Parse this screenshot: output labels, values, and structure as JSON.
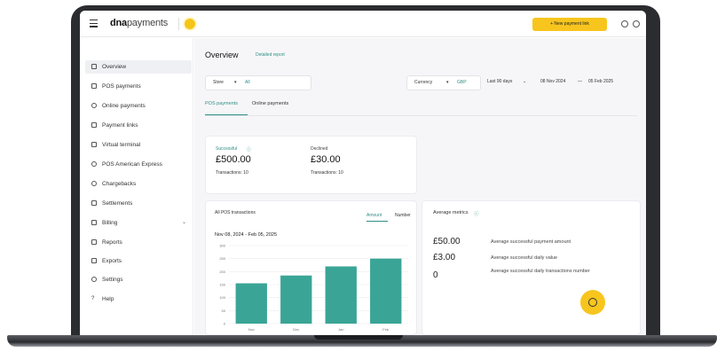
{
  "brand": {
    "bold": "dna",
    "light": "payments"
  },
  "header": {
    "new_payment_label": "+ New payment link"
  },
  "sidebar": {
    "items": [
      {
        "label": "Overview",
        "icon": "home-icon",
        "active": true
      },
      {
        "label": "POS payments",
        "icon": "pos-icon"
      },
      {
        "label": "Online payments",
        "icon": "globe-icon"
      },
      {
        "label": "Payment links",
        "icon": "link-icon"
      },
      {
        "label": "Virtual terminal",
        "icon": "terminal-icon"
      },
      {
        "label": "POS American Express",
        "icon": "amex-icon"
      },
      {
        "label": "Chargebacks",
        "icon": "chargeback-icon"
      },
      {
        "label": "Settlements",
        "icon": "document-icon"
      },
      {
        "label": "Billing",
        "icon": "billing-icon",
        "expandable": true
      },
      {
        "label": "Reports",
        "icon": "report-icon"
      },
      {
        "label": "Exports",
        "icon": "export-icon"
      },
      {
        "label": "Settings",
        "icon": "gear-icon"
      },
      {
        "label": "Help",
        "icon": "help-icon"
      }
    ]
  },
  "overview": {
    "title": "Overview",
    "detailed_report": "Detailed report"
  },
  "filters": {
    "store_label": "Store",
    "store_value": "All",
    "currency_label": "Currency",
    "currency_value": "GBP",
    "period_label": "Last 90 days",
    "date_from": "08 Nov 2024",
    "date_to": "05 Feb 2025"
  },
  "tabs": {
    "pos": "POS payments",
    "online": "Online payments"
  },
  "kpis": {
    "successful_label": "Successful",
    "successful_value": "£500.00",
    "successful_sub": "Transactions: 10",
    "declined_label": "Declined",
    "declined_value": "£30.00",
    "declined_sub": "Transactions: 10"
  },
  "chart_panel": {
    "title": "All POS transactions",
    "tab_amount": "Amount",
    "tab_number": "Number",
    "range": "Nov 08, 2024 - Feb 05, 2025"
  },
  "chart_data": {
    "type": "bar",
    "categories": [
      "Nov",
      "Dec",
      "Jan",
      "Feb"
    ],
    "values": [
      155,
      185,
      220,
      250
    ],
    "ylim": [
      0,
      300
    ],
    "yticks": [
      0,
      50,
      100,
      150,
      200,
      250,
      300
    ],
    "ytick_labels": [
      "0",
      "50",
      "100",
      "150",
      "200",
      "250",
      "300"
    ],
    "color": "#3aa596",
    "grid": true
  },
  "metrics": {
    "title": "Average metrics",
    "rows": [
      {
        "value": "£50.00",
        "label": "Average successful payment amount"
      },
      {
        "value": "£3.00",
        "label": "Average successful daily value"
      },
      {
        "value": "0",
        "label": "Average successful daily transactions number"
      }
    ]
  },
  "colors": {
    "accent": "#2f8f86",
    "brand_yellow": "#f7c51e"
  }
}
